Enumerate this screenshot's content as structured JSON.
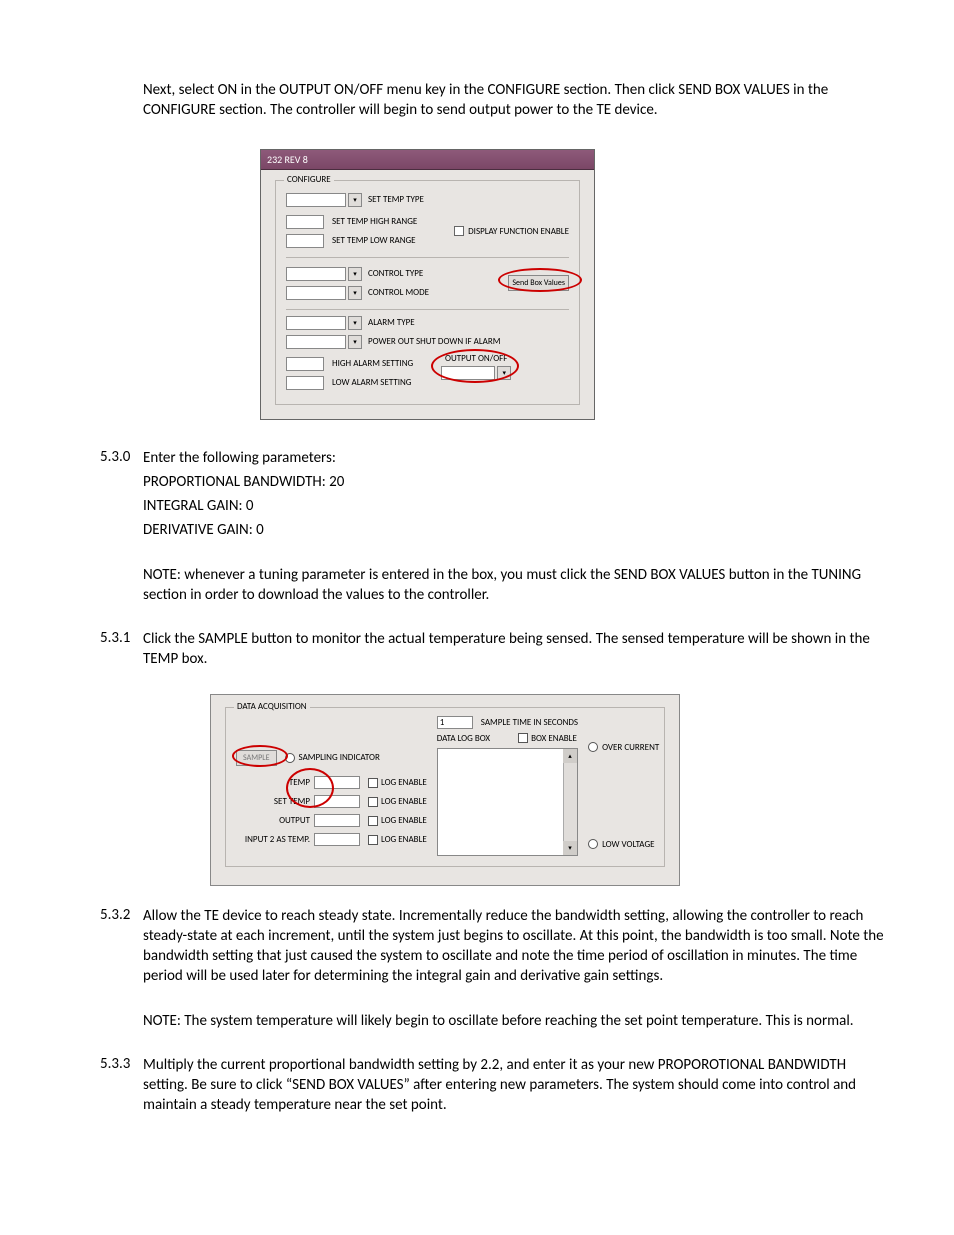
{
  "intro": "Next, select ON in the OUTPUT ON/OFF menu key in the CONFIGURE section. Then click SEND BOX VALUES in the CONFIGURE section. The controller will begin to send output power to the TE device.",
  "shot1": {
    "window_title": "232 REV 8",
    "legend": "CONFIGURE",
    "labels": {
      "set_temp_type": "SET TEMP TYPE",
      "set_temp_high": "SET TEMP HIGH RANGE",
      "set_temp_low": "SET TEMP LOW RANGE",
      "control_type": "CONTROL TYPE",
      "control_mode": "CONTROL MODE",
      "alarm_type": "ALARM TYPE",
      "power_out": "POWER OUT SHUT DOWN IF ALARM",
      "high_alarm": "HIGH ALARM SETTING",
      "low_alarm": "LOW ALARM SETTING",
      "display_fn": "DISPLAY FUNCTION ENABLE",
      "output_onoff": "OUTPUT ON/OFF",
      "send_box": "Send Box Values"
    }
  },
  "sec530": {
    "num": "5.3.0",
    "line1": "Enter the following parameters:",
    "line2": "PROPORTIONAL BANDWIDTH: 20",
    "line3": "INTEGRAL GAIN: 0",
    "line4": "DERIVATIVE GAIN: 0",
    "note": "NOTE: whenever a tuning parameter is entered in the box, you must click the SEND BOX VALUES button in the TUNING section in order to download the values to the controller."
  },
  "sec531": {
    "num": "5.3.1",
    "text": "Click the SAMPLE button to monitor the actual temperature being sensed. The sensed temperature will be shown in the TEMP box."
  },
  "shot2": {
    "legend": "DATA ACQUISITION",
    "labels": {
      "sample": "SAMPLE",
      "sampling_ind": "SAMPLING INDICATOR",
      "temp": "TEMP",
      "set_temp": "SET TEMP",
      "output": "OUTPUT",
      "input2": "INPUT 2 AS TEMP.",
      "log_enable": "LOG ENABLE",
      "sample_time": "SAMPLE TIME IN SECONDS",
      "sample_time_val": "1",
      "data_log_box": "DATA LOG BOX",
      "box_enable": "BOX ENABLE",
      "over_current": "OVER CURRENT",
      "low_voltage": "LOW VOLTAGE"
    }
  },
  "sec532": {
    "num": "5.3.2",
    "p1": "Allow the TE device to reach steady state.  Incrementally reduce the bandwidth setting, allowing the controller to reach steady-state at each increment, until the system just begins to oscillate.  At this point, the bandwidth is too small.  Note the bandwidth setting that just caused the system to oscillate and note the time period of oscillation in minutes.  The time period will be used later for determining the integral gain and derivative gain settings.",
    "note": "NOTE:  The system temperature will likely begin to oscillate before reaching the set point temperature.  This is normal."
  },
  "sec533": {
    "num": "5.3.3",
    "text": "Multiply the current proportional bandwidth setting by 2.2, and enter it as your new PROPOROTIONAL BANDWIDTH setting.  Be sure to click “SEND BOX VALUES” after entering new parameters.  The system should come into control and maintain a steady temperature near the set point."
  }
}
